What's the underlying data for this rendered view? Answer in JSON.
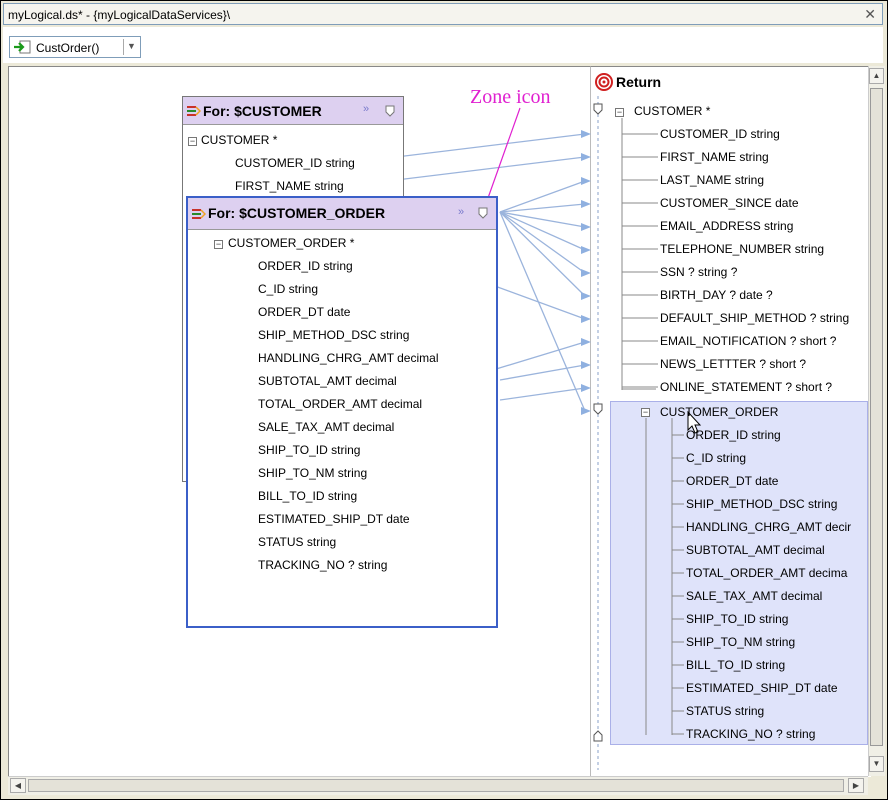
{
  "window": {
    "title": "myLogical.ds* - {myLogicalDataServices}\\",
    "close_glyph": "✕"
  },
  "toolbar": {
    "function_select": "CustOrder()"
  },
  "annotation": {
    "zone_label": "Zone icon"
  },
  "for_customer": {
    "title": "For: $CUSTOMER",
    "root": "CUSTOMER *",
    "fields": [
      "CUSTOMER_ID string",
      "FIRST_NAME string"
    ]
  },
  "for_customer_order": {
    "title": "For: $CUSTOMER_ORDER",
    "root": "CUSTOMER_ORDER *",
    "fields": [
      "ORDER_ID string",
      "C_ID string",
      "ORDER_DT date",
      "SHIP_METHOD_DSC string",
      "HANDLING_CHRG_AMT decimal",
      "SUBTOTAL_AMT decimal",
      "TOTAL_ORDER_AMT decimal",
      "SALE_TAX_AMT decimal",
      "SHIP_TO_ID string",
      "SHIP_TO_NM string",
      "BILL_TO_ID string",
      "ESTIMATED_SHIP_DT date",
      "STATUS string",
      "TRACKING_NO ? string"
    ]
  },
  "return_panel": {
    "title": "Return",
    "root": "CUSTOMER *",
    "fields": [
      "CUSTOMER_ID string",
      "FIRST_NAME string",
      "LAST_NAME string",
      "CUSTOMER_SINCE date",
      "EMAIL_ADDRESS string",
      "TELEPHONE_NUMBER string",
      "SSN ? string ?",
      "BIRTH_DAY ? date ?",
      "DEFAULT_SHIP_METHOD ? string",
      "EMAIL_NOTIFICATION ? short ?",
      "NEWS_LETTTER ? short ?",
      "ONLINE_STATEMENT ? short ?"
    ],
    "nested_root": "CUSTOMER_ORDER",
    "nested_fields": [
      "ORDER_ID string",
      "C_ID string",
      "ORDER_DT date",
      "SHIP_METHOD_DSC string",
      "HANDLING_CHRG_AMT decir",
      "SUBTOTAL_AMT decimal",
      "TOTAL_ORDER_AMT decima",
      "SALE_TAX_AMT decimal",
      "SHIP_TO_ID string",
      "SHIP_TO_NM string",
      "BILL_TO_ID string",
      "ESTIMATED_SHIP_DT date",
      "STATUS string",
      "TRACKING_NO ? string"
    ]
  },
  "colors": {
    "header_fill": "#ddd0f0",
    "annotation": "#e020d0",
    "mapping_line": "#9bb4dc",
    "zone_fill": "#dfe3fa",
    "active_border": "#3b5fc8"
  }
}
